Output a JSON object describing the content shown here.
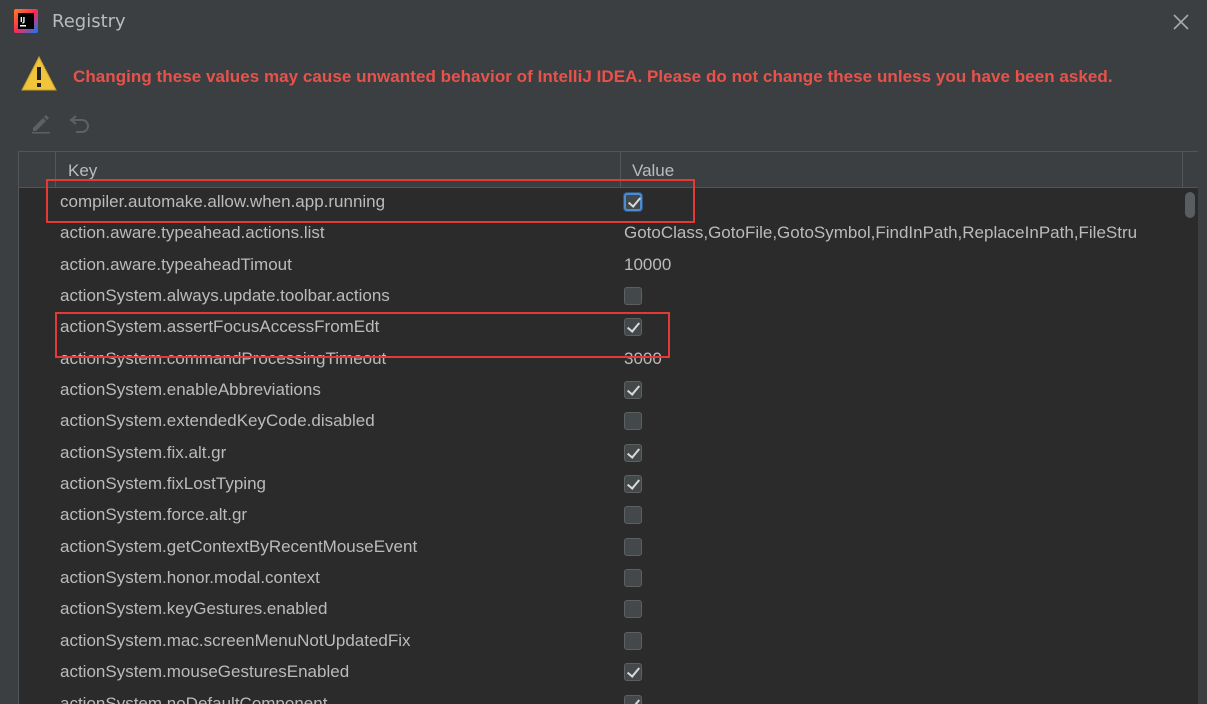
{
  "window": {
    "title": "Registry",
    "app_icon": "intellij-idea-icon",
    "close_icon": "close-icon"
  },
  "warning": {
    "icon": "warning-triangle-icon",
    "text": "Changing these values may cause unwanted behavior of IntelliJ IDEA. Please do not change these unless you have been asked.",
    "color": "#e8524a"
  },
  "toolbar": {
    "edit_icon": "edit-pencil-icon",
    "revert_icon": "revert-icon"
  },
  "table": {
    "columns": {
      "key": "Key",
      "value": "Value"
    },
    "rows": [
      {
        "key": "compiler.automake.allow.when.app.running",
        "type": "checkbox",
        "checked": true,
        "focused": true
      },
      {
        "key": "action.aware.typeahead.actions.list",
        "type": "text",
        "value": "GotoClass,GotoFile,GotoSymbol,FindInPath,ReplaceInPath,FileStru"
      },
      {
        "key": "action.aware.typeaheadTimout",
        "type": "text",
        "value": "10000"
      },
      {
        "key": "actionSystem.always.update.toolbar.actions",
        "type": "checkbox",
        "checked": false
      },
      {
        "key": "actionSystem.assertFocusAccessFromEdt",
        "type": "checkbox",
        "checked": true
      },
      {
        "key": "actionSystem.commandProcessingTimeout",
        "type": "text",
        "value": "3000"
      },
      {
        "key": "actionSystem.enableAbbreviations",
        "type": "checkbox",
        "checked": true
      },
      {
        "key": "actionSystem.extendedKeyCode.disabled",
        "type": "checkbox",
        "checked": false
      },
      {
        "key": "actionSystem.fix.alt.gr",
        "type": "checkbox",
        "checked": true
      },
      {
        "key": "actionSystem.fixLostTyping",
        "type": "checkbox",
        "checked": true
      },
      {
        "key": "actionSystem.force.alt.gr",
        "type": "checkbox",
        "checked": false
      },
      {
        "key": "actionSystem.getContextByRecentMouseEvent",
        "type": "checkbox",
        "checked": false
      },
      {
        "key": "actionSystem.honor.modal.context",
        "type": "checkbox",
        "checked": false
      },
      {
        "key": "actionSystem.keyGestures.enabled",
        "type": "checkbox",
        "checked": false
      },
      {
        "key": "actionSystem.mac.screenMenuNotUpdatedFix",
        "type": "checkbox",
        "checked": false
      },
      {
        "key": "actionSystem.mouseGesturesEnabled",
        "type": "checkbox",
        "checked": true
      },
      {
        "key": "actionSystem.noDefaultComponent",
        "type": "checkbox",
        "checked": true
      }
    ]
  },
  "highlight_color": "#e53935"
}
